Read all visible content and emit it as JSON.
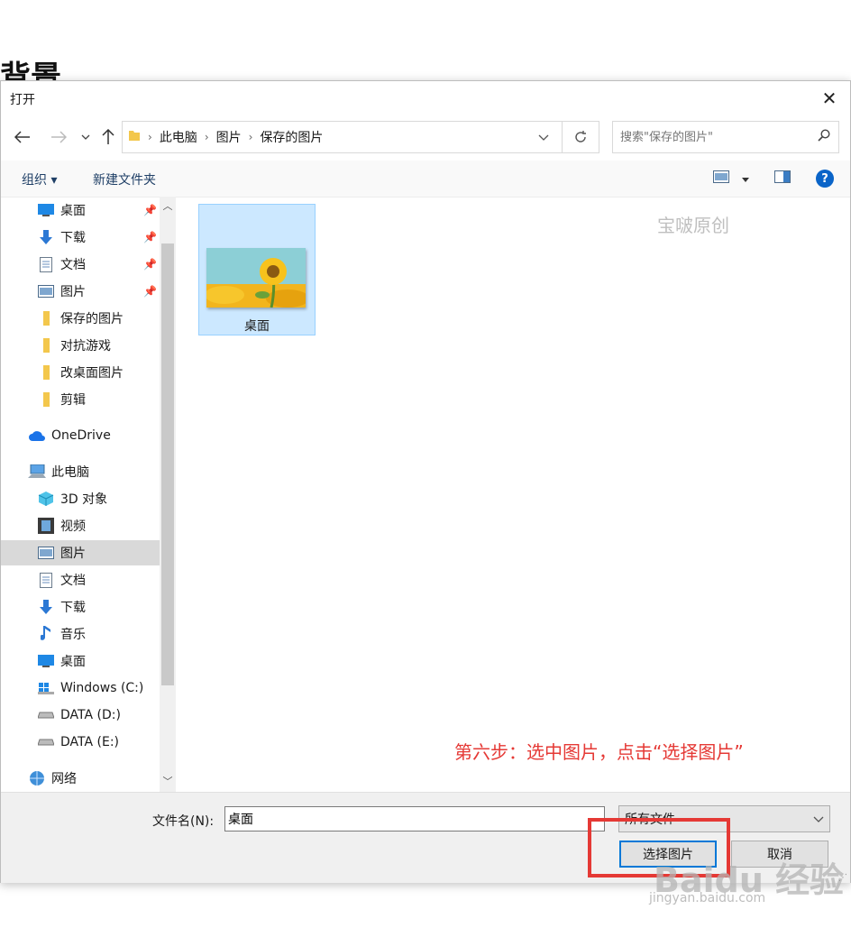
{
  "background": {
    "title_fragment": "背景"
  },
  "dialog": {
    "title": "打开",
    "close_glyph": "✕",
    "address": {
      "crumbs": [
        "此电脑",
        "图片",
        "保存的图片"
      ]
    },
    "search": {
      "placeholder": "搜索\"保存的图片\""
    },
    "toolbar": {
      "organize": "组织 ▾",
      "new_folder": "新建文件夹",
      "help": "?"
    },
    "nav_items": [
      {
        "label": "桌面",
        "icon": "desktop-icon",
        "pinned": true
      },
      {
        "label": "下载",
        "icon": "download-icon",
        "pinned": true
      },
      {
        "label": "文档",
        "icon": "document-icon",
        "pinned": true
      },
      {
        "label": "图片",
        "icon": "pictures-icon",
        "pinned": true
      },
      {
        "label": "保存的图片",
        "icon": "folder-icon",
        "pinned": false
      },
      {
        "label": "对抗游戏",
        "icon": "folder-icon",
        "pinned": false
      },
      {
        "label": "改桌面图片",
        "icon": "folder-icon",
        "pinned": false
      },
      {
        "label": "剪辑",
        "icon": "folder-icon",
        "pinned": false
      },
      {
        "label": "OneDrive",
        "icon": "cloud-icon",
        "pinned": false
      },
      {
        "label": "此电脑",
        "icon": "computer-icon",
        "pinned": false
      },
      {
        "label": "3D 对象",
        "icon": "cube-icon",
        "pinned": false
      },
      {
        "label": "视频",
        "icon": "video-icon",
        "pinned": false
      },
      {
        "label": "图片",
        "icon": "pictures-icon",
        "pinned": false,
        "selected": true
      },
      {
        "label": "文档",
        "icon": "document-icon",
        "pinned": false
      },
      {
        "label": "下载",
        "icon": "download-icon",
        "pinned": false
      },
      {
        "label": "音乐",
        "icon": "music-icon",
        "pinned": false
      },
      {
        "label": "桌面",
        "icon": "desktop-icon",
        "pinned": false
      },
      {
        "label": "Windows (C:)",
        "icon": "windows-drive-icon",
        "pinned": false
      },
      {
        "label": "DATA (D:)",
        "icon": "drive-icon",
        "pinned": false
      },
      {
        "label": "DATA (E:)",
        "icon": "drive-icon",
        "pinned": false
      },
      {
        "label": "网络",
        "icon": "network-icon",
        "pinned": false
      }
    ],
    "file": {
      "label": "桌面"
    },
    "watermark": "宝啵原创",
    "annotation": "第六步：选中图片，点击“选择图片”",
    "footer": {
      "filename_label": "文件名(N):",
      "filename_value": "桌面",
      "filetype": "所有文件",
      "open_button": "选择图片",
      "cancel_button": "取消"
    }
  },
  "baidu_watermark": {
    "logo": "Baidu 经验",
    "sub": "jingyan.baidu.com"
  },
  "colors": {
    "accent": "#0078d7",
    "selection": "#cce8ff",
    "annotation": "#e53935"
  }
}
